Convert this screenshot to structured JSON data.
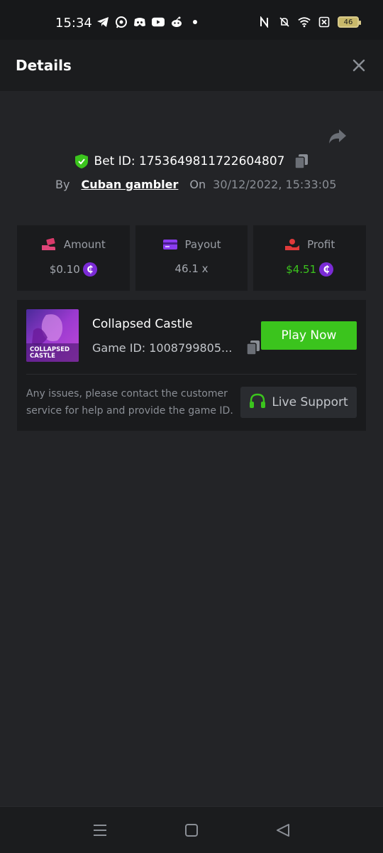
{
  "status_bar": {
    "time": "15:34",
    "left_icons": [
      "telegram-icon",
      "whatsapp-icon",
      "discord-icon",
      "youtube-icon",
      "reddit-icon",
      "dot-icon"
    ],
    "right_icons": [
      "nfc-icon",
      "bell-muted-icon",
      "wifi-icon",
      "sim-off-icon"
    ],
    "battery": "46"
  },
  "header": {
    "title": "Details"
  },
  "bet": {
    "id_label": "Bet ID: 1753649811722604807",
    "by_label": "By",
    "username": "Cuban gambler",
    "on_label": "On",
    "datetime": "30/12/2022, 15:33:05"
  },
  "stats": {
    "amount": {
      "label": "Amount",
      "value": "$0.10"
    },
    "payout": {
      "label": "Payout",
      "value": "46.1 x"
    },
    "profit": {
      "label": "Profit",
      "value": "$4.51"
    }
  },
  "coin_symbol": "₵",
  "game": {
    "name": "Collapsed Castle",
    "id_label": "Game ID: 1008799805...",
    "thumb_line1": "COLLAPSED",
    "thumb_line2": "CASTLE",
    "play_label": "Play Now",
    "help_text": "Any issues, please contact the customer service for help and provide the game ID.",
    "support_label": "Live Support"
  },
  "colors": {
    "accent_green": "#3bc41d",
    "coin_purple": "#7b2bd6",
    "background": "#232427",
    "card": "#1a1b1d"
  }
}
